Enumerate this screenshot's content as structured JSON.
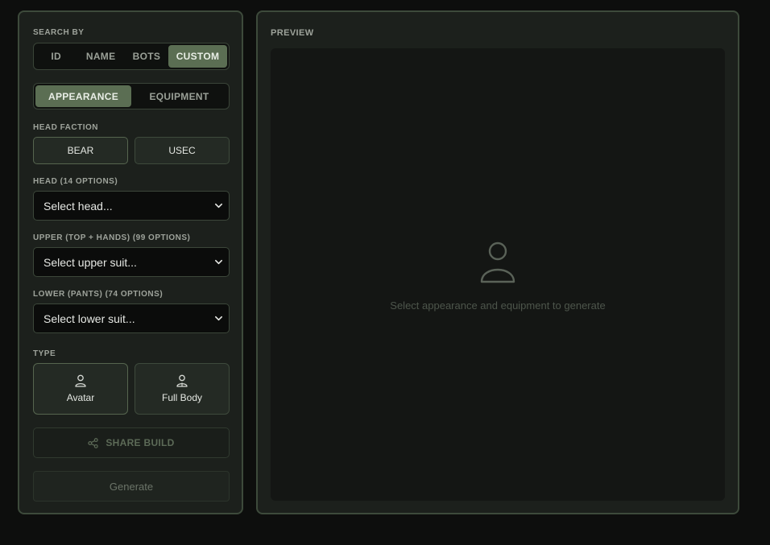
{
  "search_by": {
    "label": "SEARCH BY",
    "tabs": [
      {
        "label": "ID",
        "active": false
      },
      {
        "label": "NAME",
        "active": false
      },
      {
        "label": "BOTS",
        "active": false
      },
      {
        "label": "CUSTOM",
        "active": true
      }
    ]
  },
  "mode_tabs": [
    {
      "label": "APPEARANCE",
      "active": true
    },
    {
      "label": "EQUIPMENT",
      "active": false
    }
  ],
  "head_faction": {
    "label": "HEAD FACTION",
    "options": [
      {
        "label": "BEAR",
        "selected": true
      },
      {
        "label": "USEC",
        "selected": false
      }
    ]
  },
  "head": {
    "label": "HEAD (14 OPTIONS)",
    "placeholder": "Select head..."
  },
  "upper": {
    "label": "UPPER (TOP + HANDS) (99 OPTIONS)",
    "placeholder": "Select upper suit..."
  },
  "lower": {
    "label": "LOWER (PANTS) (74 OPTIONS)",
    "placeholder": "Select lower suit..."
  },
  "type": {
    "label": "TYPE",
    "options": [
      {
        "label": "Avatar",
        "icon": "user-icon",
        "selected": true
      },
      {
        "label": "Full Body",
        "icon": "full-body-icon",
        "selected": false
      }
    ]
  },
  "share_button": {
    "label": "SHARE BUILD",
    "icon": "share-icon"
  },
  "generate_button": {
    "label": "Generate"
  },
  "preview": {
    "title": "PREVIEW",
    "placeholder_icon": "user-icon",
    "placeholder_text": "Select appearance and equipment to generate"
  },
  "colors": {
    "accent": "#5b6e53",
    "panel_bg": "#1c201c",
    "panel_border": "#3d4a3b",
    "page_bg": "#0d0e0d"
  }
}
